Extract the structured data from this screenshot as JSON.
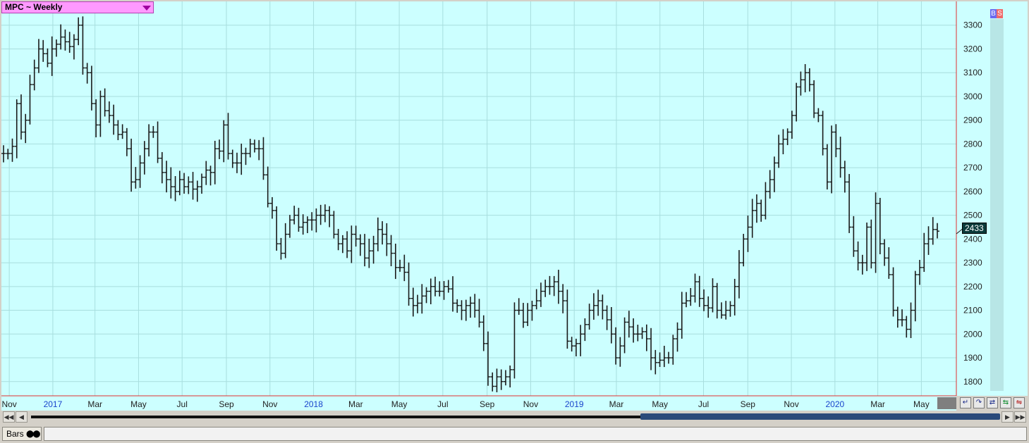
{
  "header": {
    "symbol_label": "MPC ~ Weekly"
  },
  "badges": {
    "b": "B",
    "s": "S"
  },
  "last_price_label": "2433",
  "footer": {
    "tab_label": "Bars"
  },
  "nav_icons": [
    "arrow-left-icon",
    "arrow-right-icon",
    "zoom-in-icon",
    "zoom-out-icon",
    "collapse-icon"
  ],
  "colors": {
    "plot_bg": "#ccffff",
    "grid": "#a8dede",
    "bar": "#1a1a1a",
    "border": "#e03030",
    "year_label": "#1a44cc",
    "month_label": "#222222"
  },
  "chart_data": {
    "type": "ohlc",
    "title": "MPC ~ Weekly",
    "ylim": [
      1740,
      3400
    ],
    "y_ticks": [
      1800,
      1900,
      2000,
      2100,
      2200,
      2300,
      2400,
      2500,
      2600,
      2700,
      2800,
      2900,
      3000,
      3100,
      3200,
      3300
    ],
    "x_start": "2016-10-21",
    "x_end": "2020-06-19",
    "x_ticks": [
      {
        "date": "2016-11-01",
        "label": "Nov",
        "year": false
      },
      {
        "date": "2017-01-01",
        "label": "2017",
        "year": true
      },
      {
        "date": "2017-03-01",
        "label": "Mar",
        "year": false
      },
      {
        "date": "2017-05-01",
        "label": "May",
        "year": false
      },
      {
        "date": "2017-07-01",
        "label": "Jul",
        "year": false
      },
      {
        "date": "2017-09-01",
        "label": "Sep",
        "year": false
      },
      {
        "date": "2017-11-01",
        "label": "Nov",
        "year": false
      },
      {
        "date": "2018-01-01",
        "label": "2018",
        "year": true
      },
      {
        "date": "2018-03-01",
        "label": "Mar",
        "year": false
      },
      {
        "date": "2018-05-01",
        "label": "May",
        "year": false
      },
      {
        "date": "2018-07-01",
        "label": "Jul",
        "year": false
      },
      {
        "date": "2018-09-01",
        "label": "Sep",
        "year": false
      },
      {
        "date": "2018-11-01",
        "label": "Nov",
        "year": false
      },
      {
        "date": "2019-01-01",
        "label": "2019",
        "year": true
      },
      {
        "date": "2019-03-01",
        "label": "Mar",
        "year": false
      },
      {
        "date": "2019-05-01",
        "label": "May",
        "year": false
      },
      {
        "date": "2019-07-01",
        "label": "Jul",
        "year": false
      },
      {
        "date": "2019-09-01",
        "label": "Sep",
        "year": false
      },
      {
        "date": "2019-11-01",
        "label": "Nov",
        "year": false
      },
      {
        "date": "2020-01-01",
        "label": "2020",
        "year": true
      },
      {
        "date": "2020-03-01",
        "label": "Mar",
        "year": false
      },
      {
        "date": "2020-05-01",
        "label": "May",
        "year": false
      }
    ],
    "closes": [
      2760,
      2760,
      2790,
      2970,
      2850,
      2900,
      3050,
      3120,
      3200,
      3180,
      3140,
      3200,
      3220,
      3250,
      3230,
      3210,
      3240,
      3300,
      3120,
      3100,
      2970,
      2880,
      3000,
      2940,
      2920,
      2880,
      2840,
      2850,
      2780,
      2640,
      2650,
      2720,
      2780,
      2850,
      2850,
      2740,
      2680,
      2650,
      2620,
      2600,
      2650,
      2620,
      2640,
      2610,
      2620,
      2660,
      2690,
      2680,
      2780,
      2770,
      2880,
      2760,
      2720,
      2720,
      2760,
      2760,
      2800,
      2780,
      2780,
      2670,
      2550,
      2520,
      2380,
      2340,
      2420,
      2480,
      2500,
      2450,
      2470,
      2480,
      2480,
      2500,
      2500,
      2520,
      2500,
      2420,
      2380,
      2400,
      2350,
      2420,
      2400,
      2380,
      2320,
      2350,
      2380,
      2440,
      2420,
      2380,
      2340,
      2280,
      2280,
      2260,
      2150,
      2120,
      2130,
      2160,
      2180,
      2200,
      2180,
      2180,
      2200,
      2190,
      2130,
      2120,
      2100,
      2120,
      2130,
      2100,
      2050,
      1960,
      1820,
      1780,
      1820,
      1800,
      1820,
      1850,
      2100,
      2100,
      2050,
      2100,
      2120,
      2140,
      2180,
      2200,
      2200,
      2220,
      2180,
      2140,
      1970,
      1950,
      1960,
      2000,
      2040,
      2100,
      2120,
      2140,
      2100,
      2060,
      2000,
      1900,
      1950,
      2050,
      2030,
      2000,
      2000,
      2010,
      1980,
      1900,
      1880,
      1890,
      1900,
      1900,
      1980,
      2020,
      2130,
      2140,
      2160,
      2220,
      2150,
      2120,
      2110,
      2200,
      2100,
      2080,
      2100,
      2120,
      2200,
      2300,
      2400,
      2450,
      2520,
      2550,
      2500,
      2600,
      2650,
      2720,
      2800,
      2820,
      2850,
      2920,
      3040,
      3070,
      3100,
      3050,
      2930,
      2920,
      2780,
      2640,
      2850,
      2780,
      2700,
      2640,
      2450,
      2350,
      2300,
      2300,
      2450,
      2300,
      2550,
      2380,
      2320,
      2250,
      2100,
      2060,
      2060,
      2020,
      2100,
      2250,
      2280,
      2380,
      2400,
      2440,
      2433
    ],
    "series": [
      {
        "values_ref": "closes"
      }
    ]
  }
}
